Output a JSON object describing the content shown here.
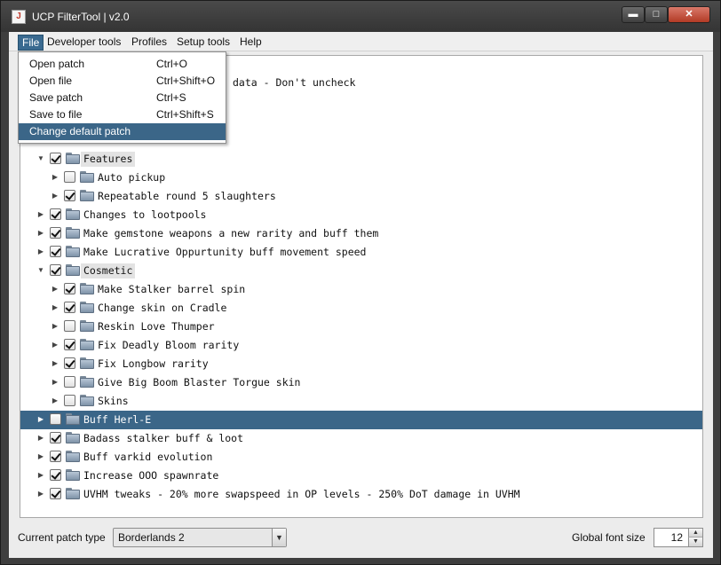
{
  "window": {
    "title": "UCP FilterTool | v2.0",
    "controls": {
      "minimize": "▬",
      "maximize": "□",
      "close": "✕"
    }
  },
  "menubar": {
    "items": [
      "File",
      "Developer tools",
      "Profiles",
      "Setup tools",
      "Help"
    ],
    "active": "File"
  },
  "file_menu": {
    "items": [
      {
        "label": "Open patch",
        "accel": "Ctrl+O"
      },
      {
        "label": "Open file",
        "accel": "Ctrl+Shift+O"
      },
      {
        "label": "Save patch",
        "accel": "Ctrl+S"
      },
      {
        "label": "Save to file",
        "accel": "Ctrl+Shift+S"
      },
      {
        "label": "Change default patch",
        "accel": ""
      }
    ],
    "highlighted_index": 4
  },
  "tree": {
    "partial_label_visible": "data - Don't uncheck",
    "nodes": [
      {
        "label": "Features",
        "level": 0,
        "expanded": true,
        "checked": true,
        "boxed": true
      },
      {
        "label": "Auto pickup",
        "level": 1,
        "expanded": false,
        "checked": false
      },
      {
        "label": "Repeatable round 5 slaughters",
        "level": 1,
        "expanded": false,
        "checked": true
      },
      {
        "label": "Changes to lootpools",
        "level": 0,
        "expanded": false,
        "checked": true
      },
      {
        "label": "Make gemstone weapons a new rarity and buff them",
        "level": 0,
        "expanded": false,
        "checked": true
      },
      {
        "label": "Make Lucrative Oppurtunity buff movement speed",
        "level": 0,
        "expanded": false,
        "checked": true
      },
      {
        "label": "Cosmetic",
        "level": 0,
        "expanded": true,
        "checked": true,
        "boxed": true
      },
      {
        "label": "Make Stalker barrel spin",
        "level": 1,
        "expanded": false,
        "checked": true
      },
      {
        "label": "Change skin on Cradle",
        "level": 1,
        "expanded": false,
        "checked": true
      },
      {
        "label": "Reskin Love Thumper",
        "level": 1,
        "expanded": false,
        "checked": false
      },
      {
        "label": "Fix Deadly Bloom rarity",
        "level": 1,
        "expanded": false,
        "checked": true
      },
      {
        "label": "Fix Longbow rarity",
        "level": 1,
        "expanded": false,
        "checked": true
      },
      {
        "label": "Give Big Boom Blaster Torgue skin",
        "level": 1,
        "expanded": false,
        "checked": false
      },
      {
        "label": "Skins",
        "level": 1,
        "expanded": false,
        "checked": false
      },
      {
        "label": "Buff Herl-E",
        "level": 0,
        "expanded": false,
        "checked": false,
        "selected": true
      },
      {
        "label": "Badass stalker buff & loot",
        "level": 0,
        "expanded": false,
        "checked": true
      },
      {
        "label": "Buff varkid evolution",
        "level": 0,
        "expanded": false,
        "checked": true
      },
      {
        "label": "Increase OOO spawnrate",
        "level": 0,
        "expanded": false,
        "checked": true
      },
      {
        "label": "UVHM tweaks - 20% more swapspeed in OP levels - 250% DoT damage in UVHM",
        "level": 0,
        "expanded": false,
        "checked": true
      }
    ]
  },
  "bottom": {
    "patch_type_label": "Current patch type",
    "patch_type_value": "Borderlands 2",
    "font_size_label": "Global font size",
    "font_size_value": "12"
  },
  "colors": {
    "selection": "#3b6688",
    "menu_active": "#3a6a90",
    "frame": "#3e3e3e"
  },
  "icons": {
    "expand": "▶",
    "collapse": "▼",
    "combo_arrow": "▼",
    "spin_up": "▲",
    "spin_down": "▼"
  }
}
